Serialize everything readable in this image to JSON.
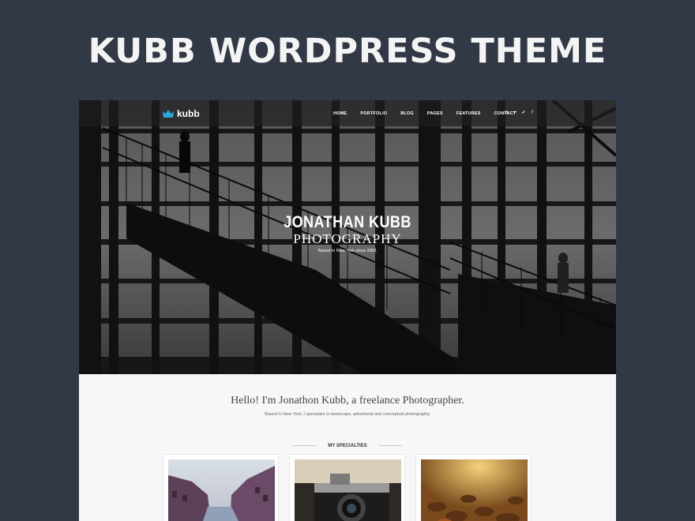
{
  "promo": {
    "title": "KUBB WORDPRESS THEME"
  },
  "site": {
    "logo": {
      "text": "kubb",
      "icon": "crown-icon",
      "accent": "#2ba6de"
    },
    "nav": {
      "items": [
        "HOME",
        "PORTFOLIO",
        "BLOG",
        "PAGES",
        "FEATURES",
        "CONTACT"
      ],
      "social_icons": [
        "instagram-icon",
        "flickr-icon",
        "twitter-icon",
        "facebook-icon"
      ]
    },
    "hero": {
      "name": "JONATHAN KUBB",
      "subtitle": "PHOTOGRAPHY",
      "tagline": "Based in New York since 2001"
    },
    "intro": {
      "heading": "Hello! I'm Jonathon Kubb, a freelance Photographer.",
      "text": "Based in New York, I specialize in landscape, advertorial and conceptual photography."
    },
    "specialties": {
      "title": "MY SPECIALTIES",
      "cards": [
        "city-canal-photo",
        "vintage-camera-photo",
        "autumn-leaves-photo"
      ]
    }
  }
}
